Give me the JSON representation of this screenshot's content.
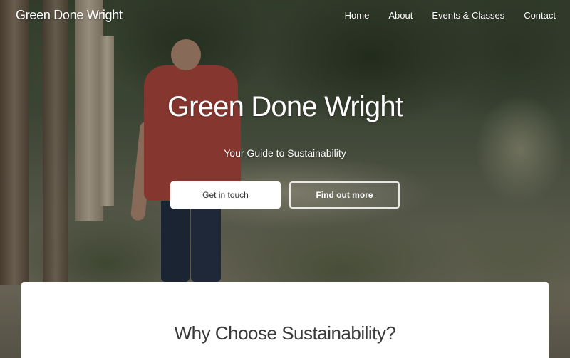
{
  "brand": {
    "name": "Green Done Wright"
  },
  "nav": {
    "items": [
      {
        "label": "Home"
      },
      {
        "label": "About"
      },
      {
        "label": "Events & Classes"
      },
      {
        "label": "Contact"
      }
    ]
  },
  "hero": {
    "title": "Green Done Wright",
    "subtitle": "Your Guide to Sustainability",
    "primary_button": "Get in touch",
    "secondary_button": "Find out more",
    "background_image": "person-walking-through-garden-photo"
  },
  "section": {
    "title": "Why Choose Sustainability?"
  },
  "colors": {
    "text_on_hero": "#ffffff",
    "button_primary_bg": "#ffffff",
    "card_bg": "#ffffff",
    "section_title": "#3a3a3a"
  }
}
